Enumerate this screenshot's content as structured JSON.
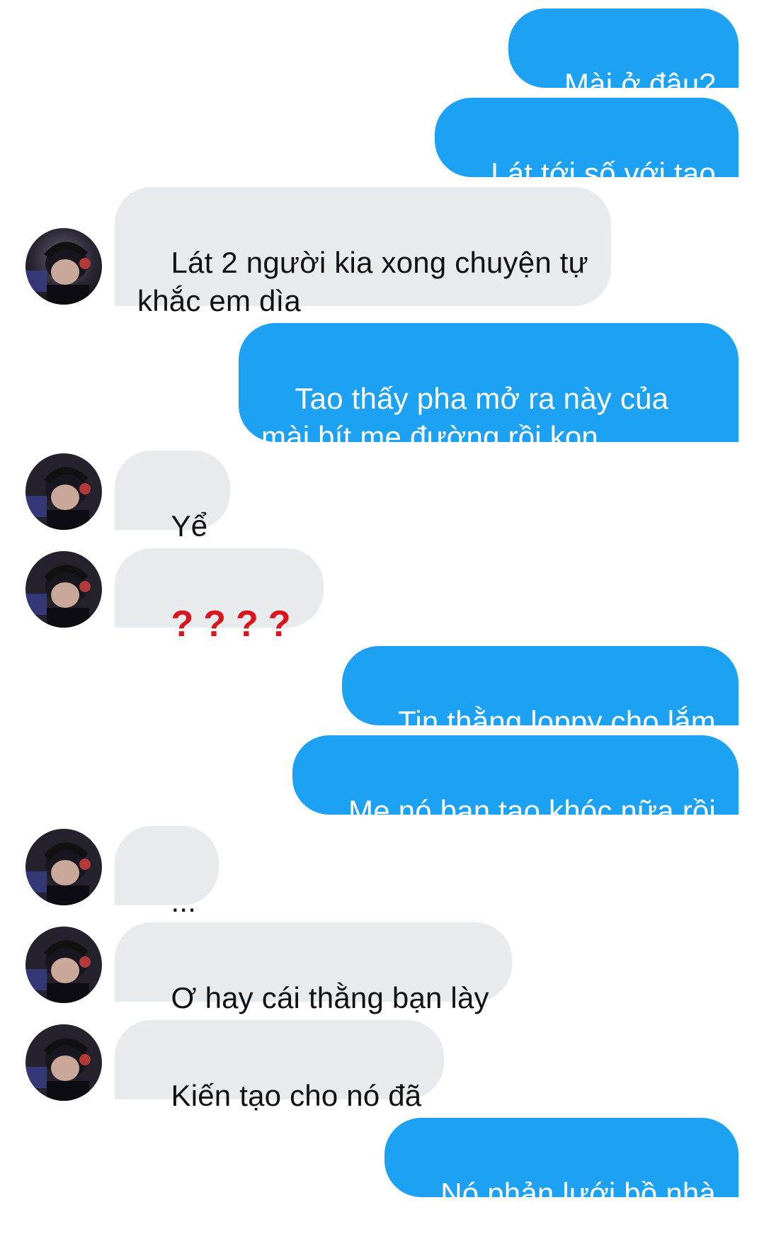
{
  "conversation": {
    "messages": [
      {
        "side": "out",
        "text": "Mài ở đâu?"
      },
      {
        "side": "out",
        "text": "Lát tới số với tao"
      },
      {
        "side": "in",
        "text": "Lát 2 người kia xong chuyện tự\nkhắc em dìa"
      },
      {
        "side": "out",
        "text": "Tao thấy pha mở ra này của\nmài bít mẹ đường rồi kon"
      },
      {
        "side": "in",
        "text": "Yể"
      },
      {
        "side": "in",
        "text": "❓❓❓❓"
      },
      {
        "side": "out",
        "text": "Tin thằng loppy cho lắm"
      },
      {
        "side": "out",
        "text": "Mẹ nó bạn tao khóc nữa rồi"
      },
      {
        "side": "in",
        "text": "..."
      },
      {
        "side": "in",
        "text": "Ơ hay cái thằng bạn lày"
      },
      {
        "side": "in",
        "text": "Kiến tạo cho nó đã"
      },
      {
        "side": "out",
        "text": "Nó phản lưới bồ nhà"
      }
    ]
  },
  "colors": {
    "outgoing_bubble": "#1da1f2",
    "incoming_bubble": "#e7ebee",
    "question_mark": "#d9141c",
    "background": "#ffffff"
  },
  "icons": {
    "avatar": "contact-avatar-photo"
  }
}
